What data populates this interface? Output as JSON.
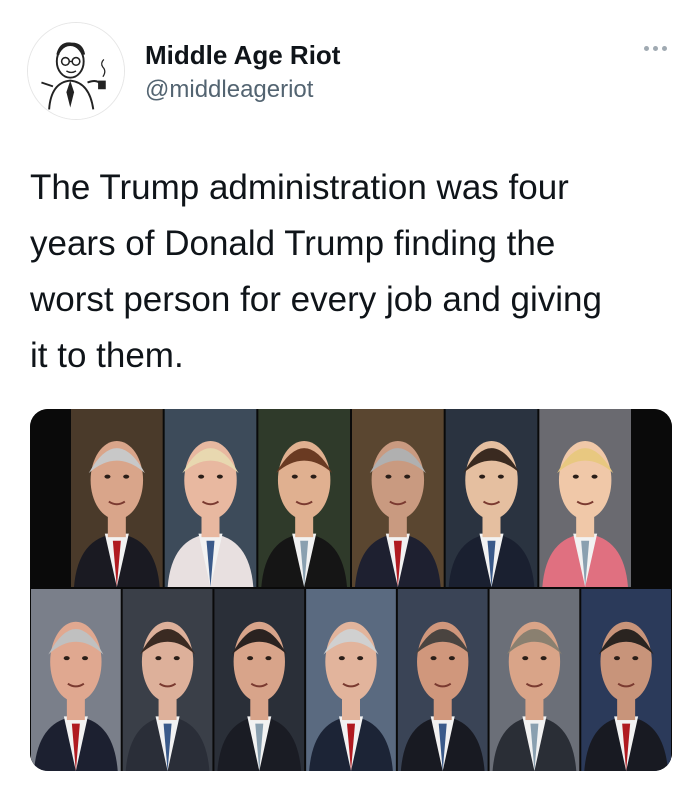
{
  "author": {
    "display_name": "Middle Age Riot",
    "handle": "@middleageriot",
    "avatar_icon": "cartoon-man-avatar"
  },
  "menu": {
    "icon": "more-dots-icon"
  },
  "tweet": {
    "text": "The Trump administration was four\nyears of Donald Trump finding the\nworst person for every job and giving\nit to them."
  },
  "media": {
    "description_icon": "photo-collage-of-officials",
    "rows": [
      {
        "count": 6
      },
      {
        "count": 7
      }
    ]
  },
  "colors": {
    "text": "#0f1419",
    "secondary": "#536471",
    "media_bg": "#0a0a0a"
  }
}
